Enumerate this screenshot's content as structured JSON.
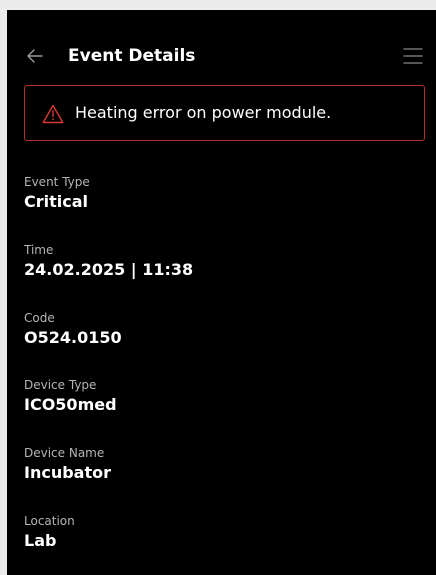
{
  "header": {
    "title": "Event Details",
    "back_icon": "arrow-left-icon",
    "menu_icon": "hamburger-menu-icon"
  },
  "alert": {
    "icon": "warning-triangle-icon",
    "message": "Heating error on power module.",
    "color": "#b3322d"
  },
  "fields": [
    {
      "label": "Event Type",
      "value": "Critical"
    },
    {
      "label": "Time",
      "value": "24.02.2025 | 11:38"
    },
    {
      "label": "Code",
      "value": "O524.0150"
    },
    {
      "label": "Device Type",
      "value": "ICO50med"
    },
    {
      "label": "Device Name",
      "value": "Incubator"
    },
    {
      "label": "Location",
      "value": "Lab"
    }
  ]
}
